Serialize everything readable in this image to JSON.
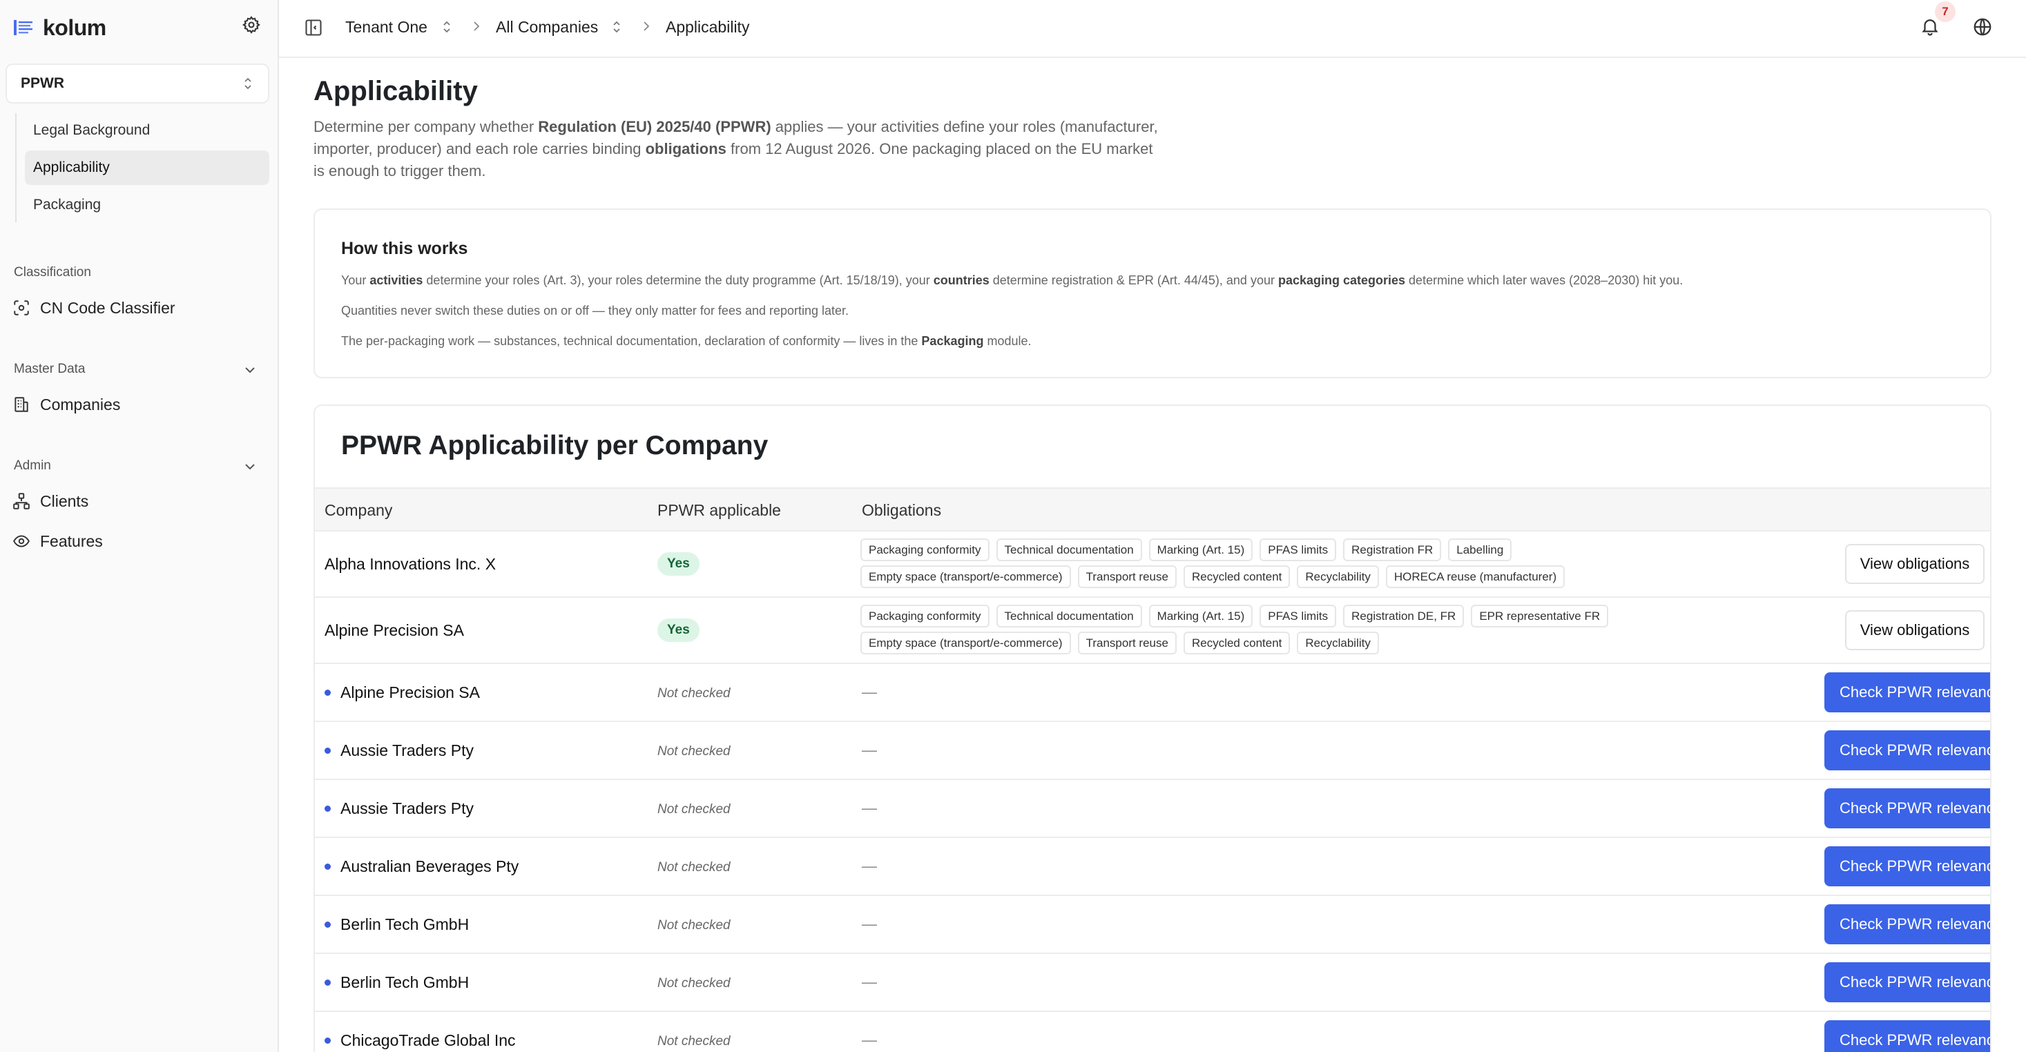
{
  "brand": {
    "name": "kolum"
  },
  "sidebar": {
    "module": "PPWR",
    "subnav": [
      {
        "label": "Legal Background",
        "active": false
      },
      {
        "label": "Applicability",
        "active": true
      },
      {
        "label": "Packaging",
        "active": false
      }
    ],
    "groups": {
      "classification": {
        "label": "Classification",
        "items": [
          {
            "label": "CN Code Classifier",
            "icon": "scan-icon"
          }
        ]
      },
      "master_data": {
        "label": "Master Data",
        "items": [
          {
            "label": "Companies",
            "icon": "building-icon"
          }
        ]
      },
      "admin": {
        "label": "Admin",
        "items": [
          {
            "label": "Clients",
            "icon": "hierarchy-icon"
          },
          {
            "label": "Features",
            "icon": "eye-icon"
          }
        ]
      }
    }
  },
  "topbar": {
    "breadcrumb": [
      "Tenant One",
      "All Companies",
      "Applicability"
    ],
    "notification_count": "7"
  },
  "page": {
    "title": "Applicability",
    "desc_1": "Determine per company whether ",
    "desc_b1": "Regulation (EU) 2025/40 (PPWR)",
    "desc_2": " applies — your activities define your roles (manufacturer, importer, producer) and each role carries binding ",
    "desc_b2": "obligations",
    "desc_3": " from 12 August 2026. One packaging placed on the EU market is enough to trigger them."
  },
  "how": {
    "title": "How this works",
    "l1_a": "Your ",
    "l1_b": "activities",
    "l1_c": " determine your roles (Art. 3), your roles determine the duty programme (Art. 15/18/19), your ",
    "l1_d": "countries",
    "l1_e": " determine registration & EPR (Art. 44/45), and your ",
    "l1_f": "packaging categories",
    "l1_g": " determine which later waves (2028–2030) hit you.",
    "l2": "Quantities never switch these duties on or off — they only matter for fees and reporting later.",
    "l3_a": "The per-packaging work — substances, technical documentation, declaration of conformity — lives in the ",
    "l3_b": "Packaging",
    "l3_c": " module."
  },
  "table": {
    "title": "PPWR Applicability per Company",
    "columns": {
      "company": "Company",
      "applicable": "PPWR applicable",
      "obligations": "Obligations"
    },
    "checked_rows": [
      {
        "company": "Alpha Innovations Inc. X",
        "applicable": "Yes",
        "tags_row1": [
          "Packaging conformity",
          "Technical documentation",
          "Marking (Art. 15)",
          "PFAS limits",
          "Registration FR",
          "Labelling"
        ],
        "tags_row2": [
          "Empty space (transport/e-commerce)",
          "Transport reuse",
          "Recycled content",
          "Recyclability",
          "HORECA reuse (manufacturer)"
        ],
        "action": "View obligations"
      },
      {
        "company": "Alpine Precision SA",
        "applicable": "Yes",
        "tags_row1": [
          "Packaging conformity",
          "Technical documentation",
          "Marking (Art. 15)",
          "PFAS limits",
          "Registration DE, FR",
          "EPR representative FR"
        ],
        "tags_row2": [
          "Empty space (transport/e-commerce)",
          "Transport reuse",
          "Recycled content",
          "Recyclability"
        ],
        "action": "View obligations"
      }
    ],
    "unchecked_rows": [
      {
        "company": "Alpine Precision SA",
        "status": "Not checked",
        "obligations": "—",
        "action": "Check PPWR relevance"
      },
      {
        "company": "Aussie Traders Pty",
        "status": "Not checked",
        "obligations": "—",
        "action": "Check PPWR relevance"
      },
      {
        "company": "Aussie Traders Pty",
        "status": "Not checked",
        "obligations": "—",
        "action": "Check PPWR relevance"
      },
      {
        "company": "Australian Beverages Pty",
        "status": "Not checked",
        "obligations": "—",
        "action": "Check PPWR relevance"
      },
      {
        "company": "Berlin Tech GmbH",
        "status": "Not checked",
        "obligations": "—",
        "action": "Check PPWR relevance"
      },
      {
        "company": "Berlin Tech GmbH",
        "status": "Not checked",
        "obligations": "—",
        "action": "Check PPWR relevance"
      },
      {
        "company": "ChicagoTrade Global Inc",
        "status": "Not checked",
        "obligations": "—",
        "action": "Check PPWR relevance"
      }
    ]
  },
  "colors": {
    "accent": "#3b63e8",
    "yes_bg": "#dcf5e7",
    "yes_fg": "#166534",
    "badge_bg": "#fde2e2"
  }
}
